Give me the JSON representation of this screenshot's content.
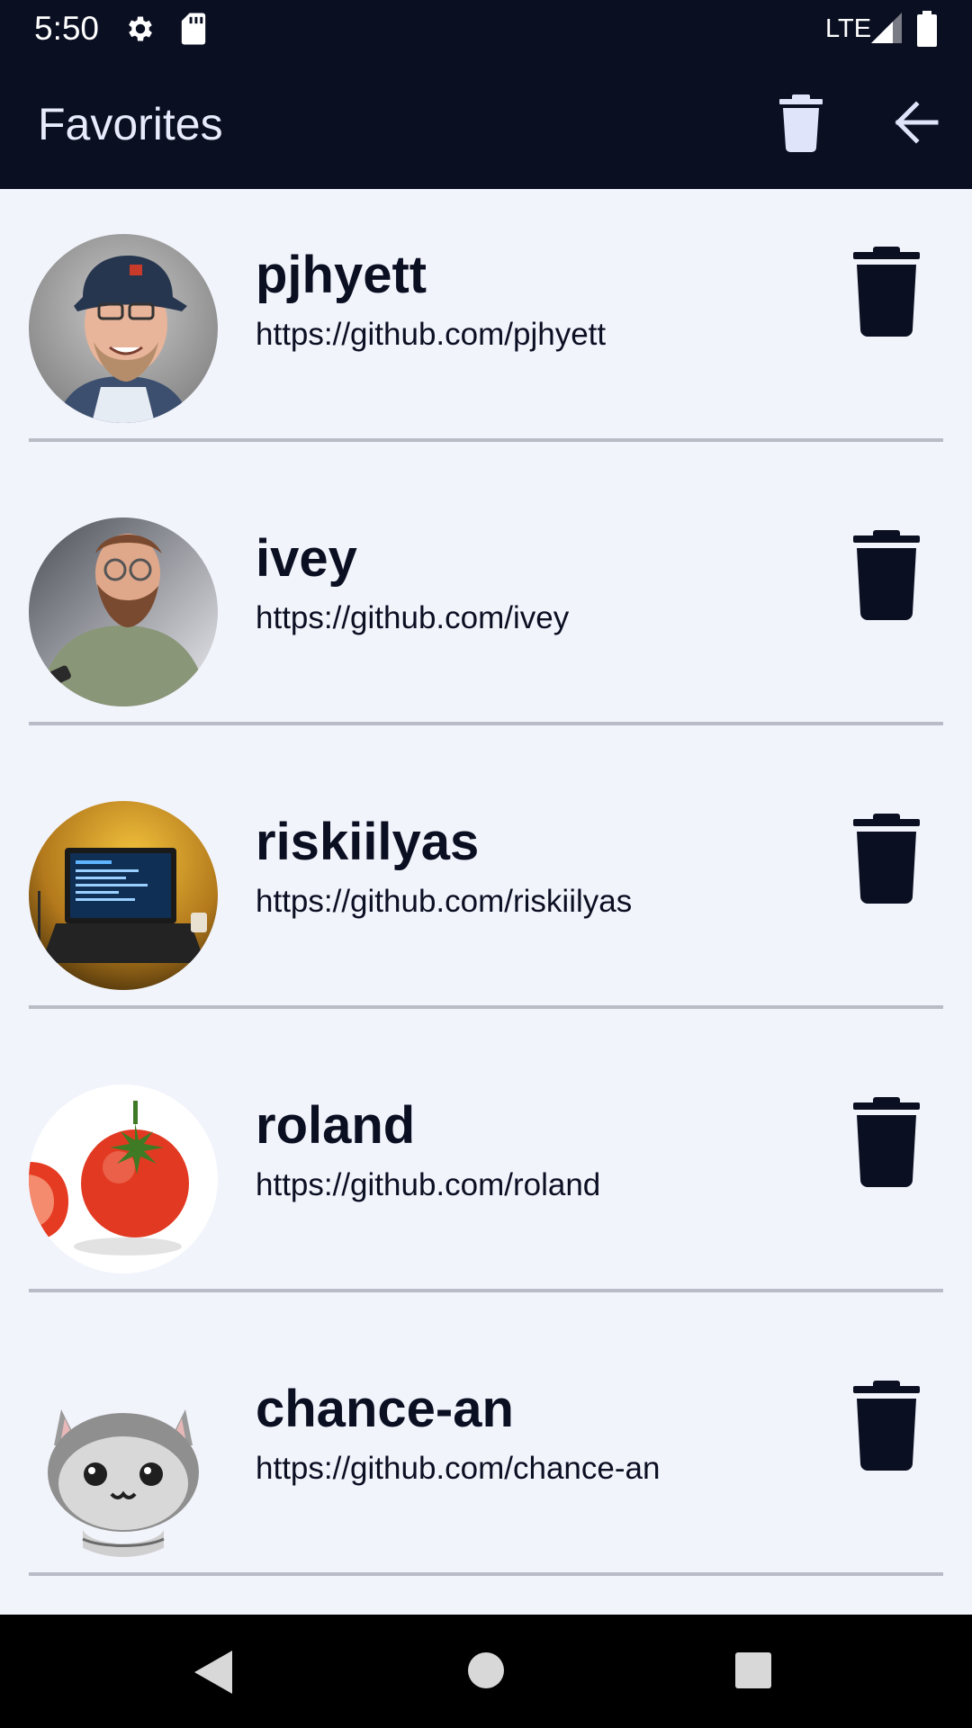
{
  "status_bar": {
    "time": "5:50",
    "network": "LTE",
    "icons": [
      "gear-icon",
      "sd-card-icon",
      "signal-icon",
      "battery-icon"
    ]
  },
  "app_bar": {
    "title": "Favorites",
    "actions": [
      "trash-icon",
      "arrow-left-icon"
    ]
  },
  "favorites": [
    {
      "name": "pjhyett",
      "url": "https://github.com/pjhyett"
    },
    {
      "name": "ivey",
      "url": "https://github.com/ivey"
    },
    {
      "name": "riskiilyas",
      "url": "https://github.com/riskiilyas"
    },
    {
      "name": "roland",
      "url": "https://github.com/roland"
    },
    {
      "name": "chance-an",
      "url": "https://github.com/chance-an"
    }
  ],
  "nav_bar": {
    "icons": [
      "nav-back-icon",
      "nav-home-icon",
      "nav-recents-icon"
    ]
  },
  "colors": {
    "bar_background": "#0b0f22",
    "page_background": "#f2f4fc",
    "text": "#0b0f22",
    "divider": "#b9bcc6",
    "app_bar_icon": "#dfe4fb"
  }
}
